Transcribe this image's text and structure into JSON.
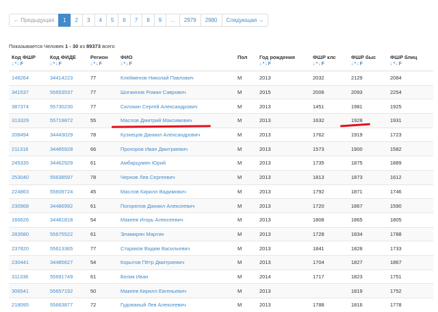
{
  "pagination": {
    "prev": "← Предыдущая",
    "pages": [
      "1",
      "2",
      "3",
      "4",
      "5",
      "6",
      "7",
      "8",
      "9",
      "...",
      "2979",
      "2980"
    ],
    "next": "Следующая →",
    "active_page": "1"
  },
  "summary": {
    "prefix": "Показывается Человек ",
    "range": "1 - 30",
    "middle": " из ",
    "total": "89373",
    "suffix": " всего"
  },
  "table": {
    "headers": [
      "Код ФШР",
      "Код ФИДЕ",
      "Регион",
      "ФИО",
      "Пол",
      "Год рождения",
      "ФШР клс",
      "ФШР быс",
      "ФШР блиц"
    ],
    "sort_icon": "↓ª↓F",
    "rows": [
      [
        "148264",
        "34414223",
        "77",
        "Клейменов Николай Павлович",
        "М",
        "2013",
        "2032",
        "2129",
        "2084"
      ],
      [
        "341537",
        "55653537",
        "77",
        "Шогжинов Роман Саврович",
        "М",
        "2015",
        "2006",
        "2093",
        "2254"
      ],
      [
        "387374",
        "55730230",
        "77",
        "Силокин Сергей Александрович",
        "М",
        "2013",
        "1451",
        "1981",
        "1925"
      ],
      [
        "313329",
        "55719872",
        "55",
        "Маслов Дмитрий Максимович",
        "М",
        "2013",
        "1632",
        "1928",
        "1931"
      ],
      [
        "208494",
        "34443029",
        "78",
        "Кузнецов Даниил Александрович",
        "М",
        "2013",
        "1762",
        "1919",
        "1723"
      ],
      [
        "211316",
        "34465928",
        "66",
        "Прохоров Иван Дмитриевич",
        "М",
        "2013",
        "1573",
        "1900",
        "1582"
      ],
      [
        "245335",
        "34462929",
        "61",
        "Амбарцумян Юрий",
        "М",
        "2013",
        "1735",
        "1875",
        "1889"
      ],
      [
        "253040",
        "55638597",
        "78",
        "Чернов Лев Сергеевич",
        "М",
        "2013",
        "1813",
        "1873",
        "1612"
      ],
      [
        "224863",
        "55609724",
        "45",
        "Маслов Кирилл Вадимович",
        "М",
        "2013",
        "1792",
        "1871",
        "1746"
      ],
      [
        "230968",
        "34486992",
        "61",
        "Погорелов Даниил Алексеевич",
        "М",
        "2013",
        "1720",
        "1867",
        "1590"
      ],
      [
        "166626",
        "34481818",
        "54",
        "Макеев Игорь Алексеевич",
        "М",
        "2013",
        "1808",
        "1865",
        "1805"
      ],
      [
        "283580",
        "55675522",
        "61",
        "Эламирян Мартин",
        "М",
        "2013",
        "1728",
        "1834",
        "1788"
      ],
      [
        "237820",
        "55613365",
        "77",
        "Стариков Вадим Васильевич",
        "М",
        "2013",
        "1841",
        "1828",
        "1733"
      ],
      [
        "230441",
        "34485627",
        "54",
        "Корытов Пётр Дмитриевич",
        "М",
        "2013",
        "1704",
        "1827",
        "1867"
      ],
      [
        "311336",
        "55691749",
        "61",
        "Белик Иван",
        "М",
        "2014",
        "1717",
        "1823",
        "1751"
      ],
      [
        "306541",
        "55657192",
        "50",
        "Макеев Кирилл Евгеньевич",
        "М",
        "2013",
        "",
        "1819",
        "1752"
      ],
      [
        "218095",
        "55663877",
        "72",
        "Гудованый Лев Алексеевич",
        "М",
        "2013",
        "1788",
        "1816",
        "1778"
      ]
    ]
  },
  "accent_color": "#428bca",
  "marker_color": "#e0101a"
}
